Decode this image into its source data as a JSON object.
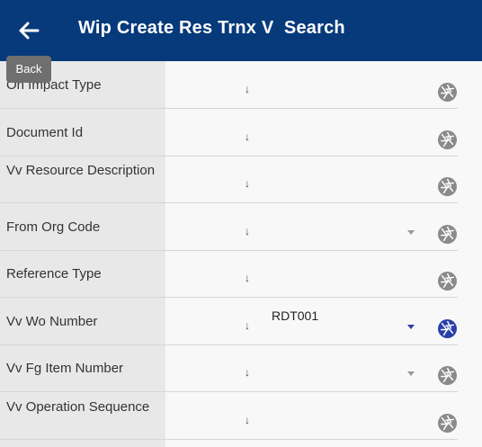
{
  "header": {
    "title": "Wip Create Res Trnx V  Search",
    "back_tooltip": "Back",
    "bg_color": "#073a7a"
  },
  "icons": {
    "back": "arrow-left-icon",
    "operator": "arrow-down-icon",
    "shutter": "camera-shutter-icon",
    "dropdown": "caret-down-icon"
  },
  "fields": [
    {
      "label": "On Impact Type",
      "value": "",
      "has_dropdown": false
    },
    {
      "label": "Document Id",
      "value": "",
      "has_dropdown": false
    },
    {
      "label": "Vv Resource Description",
      "value": "",
      "has_dropdown": false
    },
    {
      "label": "From Org Code",
      "value": "",
      "has_dropdown": true
    },
    {
      "label": "Reference Type",
      "value": "",
      "has_dropdown": false
    },
    {
      "label": "Vv Wo Number",
      "value": "RDT001",
      "has_dropdown": true
    },
    {
      "label": "Vv Fg Item Number",
      "value": "",
      "has_dropdown": true
    },
    {
      "label": "Vv Operation Sequence",
      "value": "",
      "has_dropdown": false
    }
  ]
}
